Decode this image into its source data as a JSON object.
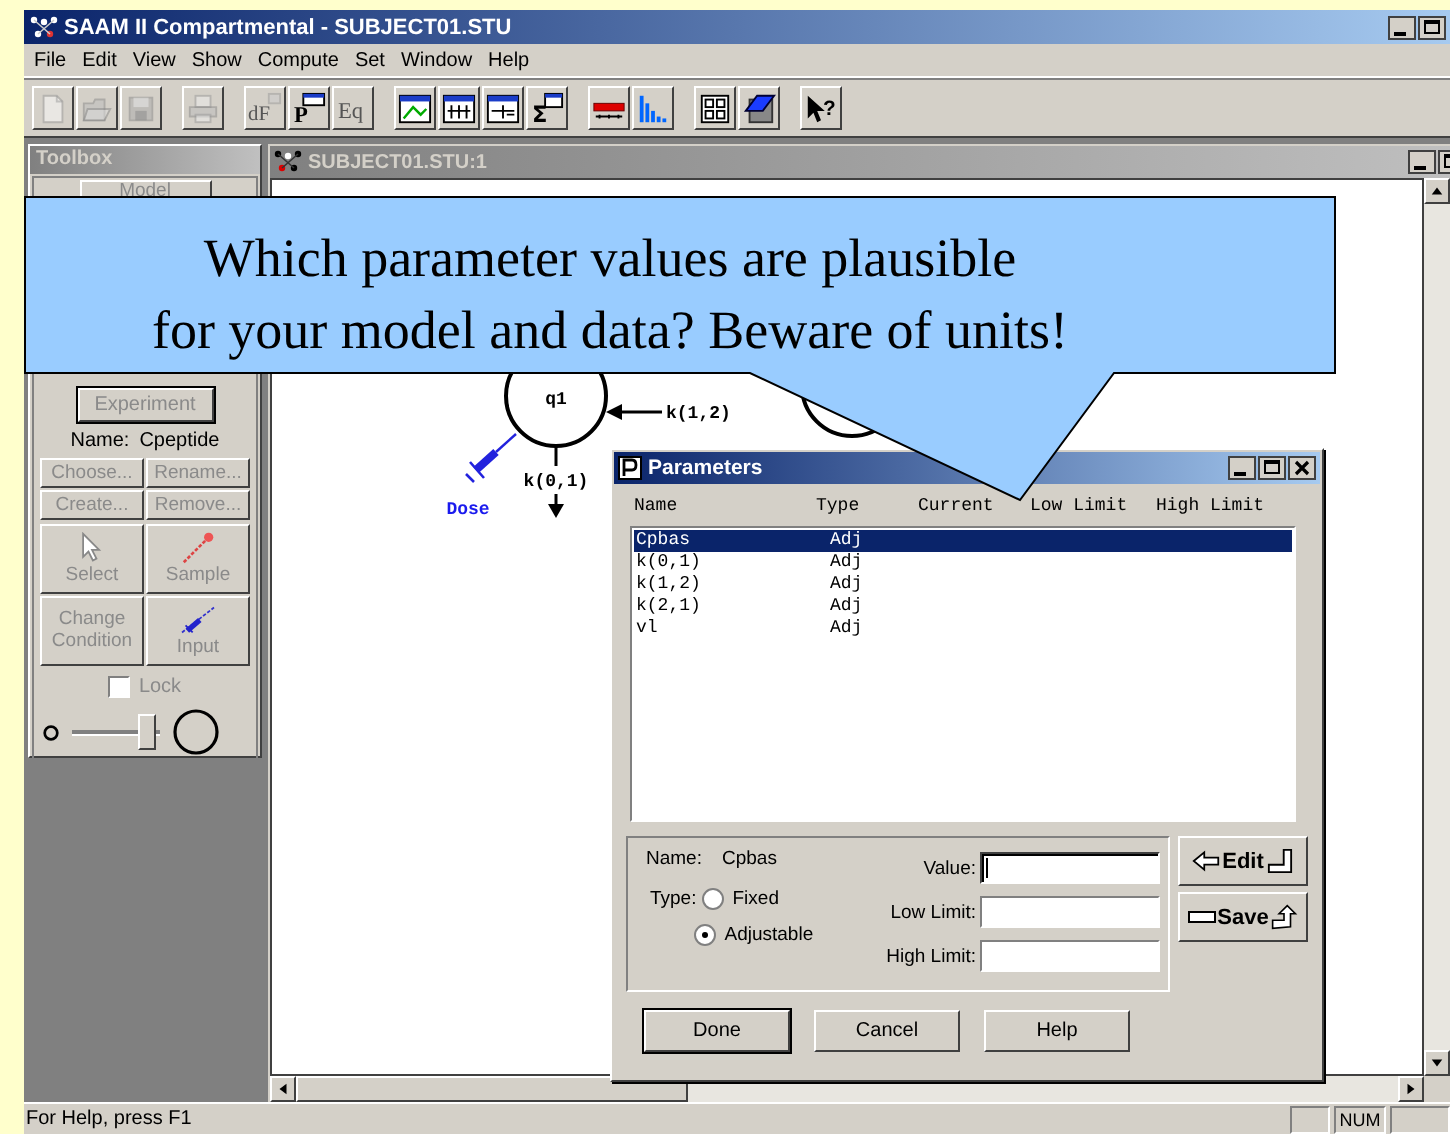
{
  "window": {
    "title": "SAAM II Compartmental - SUBJECT01.STU"
  },
  "menu": [
    {
      "label": "File"
    },
    {
      "label": "Edit"
    },
    {
      "label": "View"
    },
    {
      "label": "Show"
    },
    {
      "label": "Compute"
    },
    {
      "label": "Set"
    },
    {
      "label": "Window"
    },
    {
      "label": "Help"
    }
  ],
  "toolbar": [
    {
      "kind": "new",
      "disabled": true
    },
    {
      "kind": "open",
      "disabled": true
    },
    {
      "kind": "save",
      "disabled": true
    },
    {
      "kind": "print",
      "disabled": true
    },
    {
      "kind": "derivative",
      "text": "dF",
      "disabled": true
    },
    {
      "kind": "parameters",
      "text": "P",
      "disabled": false
    },
    {
      "kind": "equation",
      "text": "Eq",
      "disabled": true
    },
    {
      "kind": "plot",
      "disabled": false
    },
    {
      "kind": "table",
      "disabled": false
    },
    {
      "kind": "table2",
      "disabled": false
    },
    {
      "kind": "sum",
      "text": "Σ",
      "disabled": false
    },
    {
      "kind": "redbar",
      "disabled": false
    },
    {
      "kind": "histogram",
      "disabled": false
    },
    {
      "kind": "grid",
      "disabled": false
    },
    {
      "kind": "notebook",
      "disabled": false
    },
    {
      "kind": "help",
      "text": "?",
      "disabled": false
    }
  ],
  "toolbox": {
    "title": "Toolbox",
    "model_button": {
      "label": "Model",
      "disabled": true
    },
    "experiment_button": {
      "label": "Experiment",
      "disabled": true
    },
    "name_label": "Name:",
    "name_value": "Cpeptide",
    "buttons": [
      {
        "label": "Choose...",
        "disabled": true
      },
      {
        "label": "Rename...",
        "disabled": true
      },
      {
        "label": "Create...",
        "disabled": true
      },
      {
        "label": "Remove...",
        "disabled": true
      }
    ],
    "tools": [
      {
        "kind": "select",
        "label": "Select",
        "disabled": true
      },
      {
        "kind": "sample",
        "label": "Sample",
        "disabled": true
      },
      {
        "kind": "change",
        "label": "Change Condition",
        "disabled": true
      },
      {
        "kind": "input",
        "label": "Input",
        "disabled": true
      }
    ],
    "lock": {
      "label": "Lock",
      "checked": false
    },
    "size_slider": {
      "level": 0.88
    }
  },
  "document": {
    "title": "SUBJECT01.STU:1",
    "compartment_label": "q1",
    "transfer_label": "k(1,2)",
    "loss_label": "k(0,1)",
    "input_label": "Dose"
  },
  "callout": {
    "lines": [
      "Which parameter values are plausible",
      "for your model and data? Beware of units!"
    ]
  },
  "dialog": {
    "title": "Parameters",
    "columns": [
      "Name",
      "Type",
      "Current",
      "Low Limit",
      "High Limit"
    ],
    "rows": [
      {
        "name": "Cpbas",
        "type": "Adj",
        "selected": true
      },
      {
        "name": "k(0,1)",
        "type": "Adj",
        "selected": false
      },
      {
        "name": "k(1,2)",
        "type": "Adj",
        "selected": false
      },
      {
        "name": "k(2,1)",
        "type": "Adj",
        "selected": false
      },
      {
        "name": "vl",
        "type": "Adj",
        "selected": false
      }
    ],
    "name_label": "Name:",
    "name_value": "Cpbas",
    "type_label": "Type:",
    "type_options": [
      {
        "label": "Fixed",
        "selected": false
      },
      {
        "label": "Adjustable",
        "selected": true
      }
    ],
    "fields": [
      {
        "label": "Value:",
        "focused": true
      },
      {
        "label": "Low Limit:",
        "focused": false
      },
      {
        "label": "High Limit:",
        "focused": false
      }
    ],
    "side_buttons": [
      {
        "kind": "edit",
        "label": "Edit"
      },
      {
        "kind": "save",
        "label": "Save"
      }
    ],
    "buttons": [
      {
        "label": "Done",
        "default": true
      },
      {
        "label": "Cancel",
        "default": false
      },
      {
        "label": "Help",
        "default": false
      }
    ]
  },
  "status_bar": {
    "text": "For Help, press F1",
    "indicators": [
      {
        "label": "NUM"
      }
    ]
  }
}
